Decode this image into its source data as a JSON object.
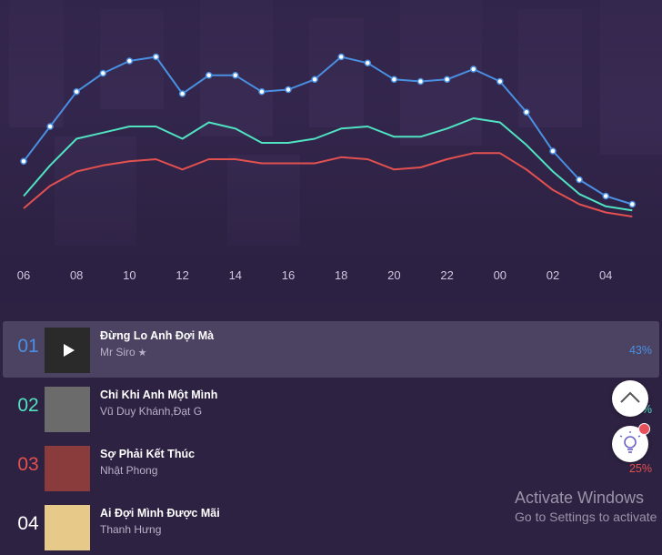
{
  "chart_data": {
    "type": "line",
    "x": [
      "06",
      "07",
      "08",
      "09",
      "10",
      "11",
      "12",
      "13",
      "14",
      "15",
      "16",
      "17",
      "18",
      "19",
      "20",
      "21",
      "22",
      "23",
      "00",
      "01",
      "02",
      "03",
      "04",
      "05"
    ],
    "x_tick_labels": [
      "06",
      "08",
      "10",
      "12",
      "14",
      "16",
      "18",
      "20",
      "22",
      "00",
      "02",
      "04"
    ],
    "series": [
      {
        "color": "#4a90e2",
        "markers": true,
        "values": [
          39,
          56,
          73,
          82,
          88,
          90,
          72,
          81,
          81,
          73,
          74,
          79,
          90,
          87,
          79,
          78,
          79,
          84,
          78,
          63,
          44,
          30,
          22,
          18
        ]
      },
      {
        "color": "#50e3c2",
        "markers": false,
        "values": [
          22,
          37,
          50,
          53,
          56,
          56,
          50,
          58,
          55,
          48,
          48,
          50,
          55,
          56,
          51,
          51,
          55,
          60,
          58,
          47,
          34,
          23,
          17,
          15
        ]
      },
      {
        "color": "#e35050",
        "markers": false,
        "values": [
          16,
          27,
          34,
          37,
          39,
          40,
          35,
          40,
          40,
          38,
          38,
          38,
          41,
          40,
          35,
          36,
          40,
          43,
          43,
          35,
          25,
          18,
          14,
          12
        ]
      }
    ],
    "ylim": [
      0,
      100
    ],
    "grid": false,
    "legend": "none"
  },
  "songs": [
    {
      "rank": "01",
      "rank_color": "#4a90e2",
      "title": "Đừng Lo Anh Đợi Mà",
      "artist": "Mr Siro",
      "artist_star": "★",
      "percent": "43%",
      "thumb_icon": "play-icon",
      "thumb_color": "#2a2a2a"
    },
    {
      "rank": "02",
      "rank_color": "#50e3c2",
      "title": "Chỉ Khi Anh Một Mình",
      "artist": "Vũ Duy Khánh,Đạt G",
      "artist_star": "",
      "percent": "%",
      "thumb_color": "#6b6b6b"
    },
    {
      "rank": "03",
      "rank_color": "#e35050",
      "title": "Sợ Phải Kết Thúc",
      "artist": "Nhật Phong",
      "artist_star": "",
      "percent": "25%",
      "thumb_color": "#8a3b3b"
    },
    {
      "rank": "04",
      "rank_color": "#ffffff",
      "title": "Ai Đợi Mình Được Mãi",
      "artist": "Thanh Hưng",
      "artist_star": "",
      "percent": "",
      "thumb_color": "#e7c98a"
    }
  ],
  "floating_buttons": {
    "scroll_top_icon": "chevron-up-icon",
    "idea_icon": "lightbulb-icon"
  },
  "watermark": {
    "line1": "Activate Windows",
    "line2": "Go to Settings to activate"
  }
}
